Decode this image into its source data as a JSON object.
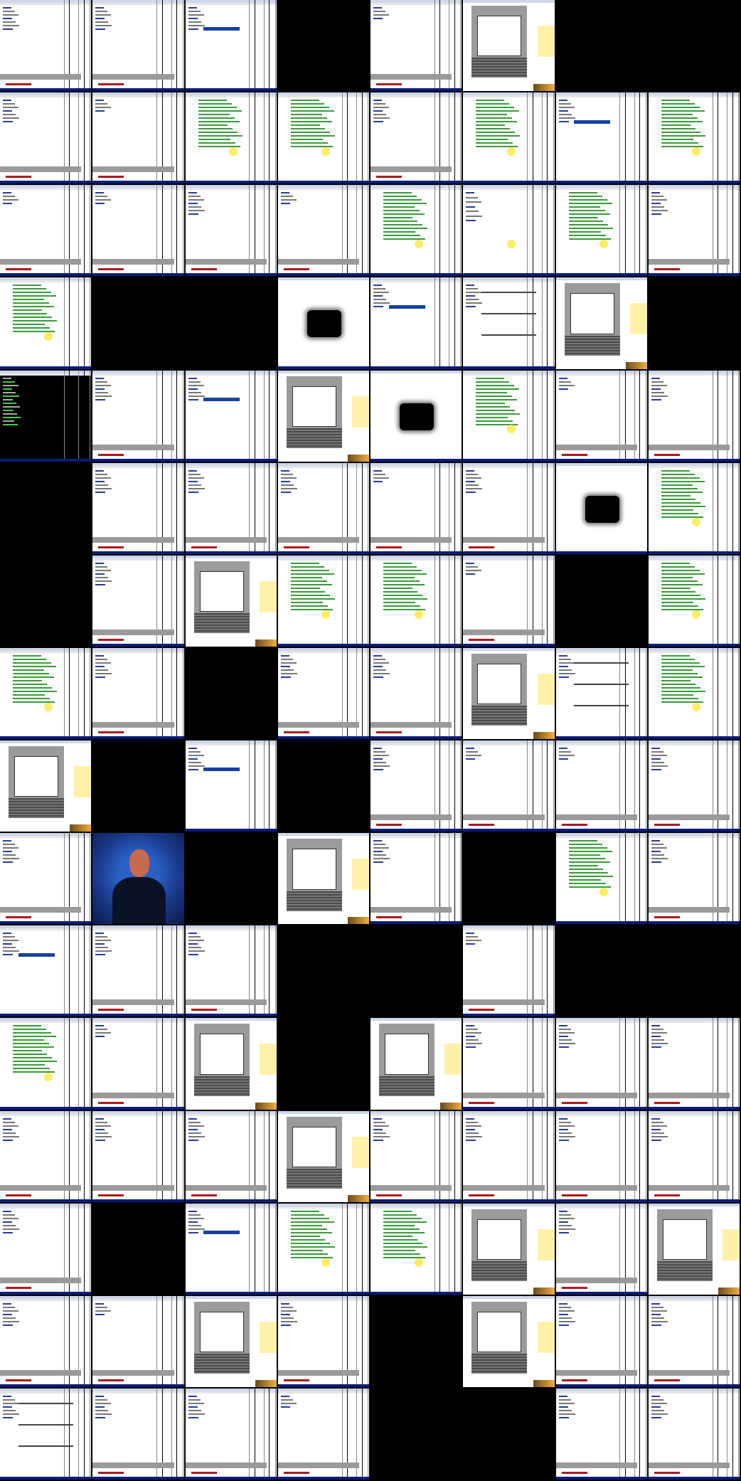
{
  "screen": {
    "description_free": true,
    "tiles": [
      {
        "k": "win",
        "v": 0
      },
      {
        "k": "win",
        "v": 0
      },
      {
        "k": "win",
        "v": 1
      },
      {
        "k": "blank"
      },
      {
        "k": "win",
        "v": 2
      },
      {
        "k": "dlg"
      },
      {
        "k": "blank"
      },
      {
        "k": "blank"
      },
      {
        "k": "win",
        "v": 0
      },
      {
        "k": "win",
        "v": 2
      },
      {
        "k": "win",
        "v": 3
      },
      {
        "k": "win",
        "v": 3
      },
      {
        "k": "win",
        "v": 0
      },
      {
        "k": "win",
        "v": 3
      },
      {
        "k": "win",
        "v": 1
      },
      {
        "k": "win",
        "v": 3
      },
      {
        "k": "win",
        "v": 2
      },
      {
        "k": "win",
        "v": 2
      },
      {
        "k": "win",
        "v": 0
      },
      {
        "k": "win",
        "v": 2
      },
      {
        "k": "win",
        "v": 3
      },
      {
        "k": "win",
        "v": 4
      },
      {
        "k": "win",
        "v": 3
      },
      {
        "k": "win",
        "v": 0
      },
      {
        "k": "win",
        "v": 3
      },
      {
        "k": "blank"
      },
      {
        "k": "blank"
      },
      {
        "k": "box"
      },
      {
        "k": "win",
        "v": 1
      },
      {
        "k": "win",
        "v": 5
      },
      {
        "k": "dlg"
      },
      {
        "k": "blank"
      },
      {
        "k": "win",
        "v": 6
      },
      {
        "k": "win",
        "v": 0
      },
      {
        "k": "win",
        "v": 1
      },
      {
        "k": "dlg"
      },
      {
        "k": "box"
      },
      {
        "k": "win",
        "v": 3
      },
      {
        "k": "win",
        "v": 2
      },
      {
        "k": "win",
        "v": 0
      },
      {
        "k": "blank"
      },
      {
        "k": "win",
        "v": 0
      },
      {
        "k": "win",
        "v": 0
      },
      {
        "k": "win",
        "v": 0
      },
      {
        "k": "win",
        "v": 2
      },
      {
        "k": "win",
        "v": 0
      },
      {
        "k": "box"
      },
      {
        "k": "win",
        "v": 3
      },
      {
        "k": "blank"
      },
      {
        "k": "win",
        "v": 0
      },
      {
        "k": "dlg"
      },
      {
        "k": "win",
        "v": 3
      },
      {
        "k": "win",
        "v": 3
      },
      {
        "k": "win",
        "v": 2
      },
      {
        "k": "blank"
      },
      {
        "k": "win",
        "v": 3
      },
      {
        "k": "win",
        "v": 3
      },
      {
        "k": "win",
        "v": 0
      },
      {
        "k": "blank"
      },
      {
        "k": "win",
        "v": 0
      },
      {
        "k": "win",
        "v": 0
      },
      {
        "k": "dlg"
      },
      {
        "k": "win",
        "v": 5
      },
      {
        "k": "win",
        "v": 3
      },
      {
        "k": "dlg"
      },
      {
        "k": "blank"
      },
      {
        "k": "win",
        "v": 1
      },
      {
        "k": "blank"
      },
      {
        "k": "win",
        "v": 0
      },
      {
        "k": "win",
        "v": 2
      },
      {
        "k": "win",
        "v": 2
      },
      {
        "k": "win",
        "v": 0
      },
      {
        "k": "win",
        "v": 0
      },
      {
        "k": "photo"
      },
      {
        "k": "blank"
      },
      {
        "k": "dlg"
      },
      {
        "k": "win",
        "v": 0
      },
      {
        "k": "blank"
      },
      {
        "k": "win",
        "v": 3
      },
      {
        "k": "win",
        "v": 0
      },
      {
        "k": "win",
        "v": 1
      },
      {
        "k": "win",
        "v": 0
      },
      {
        "k": "win",
        "v": 0
      },
      {
        "k": "blank"
      },
      {
        "k": "blank"
      },
      {
        "k": "win",
        "v": 2
      },
      {
        "k": "blank"
      },
      {
        "k": "blank"
      },
      {
        "k": "win",
        "v": 3
      },
      {
        "k": "win",
        "v": 2
      },
      {
        "k": "dlg"
      },
      {
        "k": "blank"
      },
      {
        "k": "dlg"
      },
      {
        "k": "win",
        "v": 0
      },
      {
        "k": "win",
        "v": 0
      },
      {
        "k": "win",
        "v": 0
      },
      {
        "k": "win",
        "v": 0
      },
      {
        "k": "win",
        "v": 0
      },
      {
        "k": "win",
        "v": 0
      },
      {
        "k": "dlg"
      },
      {
        "k": "win",
        "v": 0
      },
      {
        "k": "win",
        "v": 0
      },
      {
        "k": "win",
        "v": 0
      },
      {
        "k": "win",
        "v": 0
      },
      {
        "k": "win",
        "v": 0
      },
      {
        "k": "blank"
      },
      {
        "k": "win",
        "v": 1
      },
      {
        "k": "win",
        "v": 3
      },
      {
        "k": "win",
        "v": 3
      },
      {
        "k": "dlg"
      },
      {
        "k": "win",
        "v": 0
      },
      {
        "k": "dlg"
      },
      {
        "k": "win",
        "v": 0
      },
      {
        "k": "win",
        "v": 2
      },
      {
        "k": "dlg"
      },
      {
        "k": "win",
        "v": 0
      },
      {
        "k": "blank"
      },
      {
        "k": "dlg"
      },
      {
        "k": "win",
        "v": 0
      },
      {
        "k": "win",
        "v": 0
      },
      {
        "k": "win",
        "v": 5
      },
      {
        "k": "win",
        "v": 0
      },
      {
        "k": "win",
        "v": 0
      },
      {
        "k": "win",
        "v": 2
      },
      {
        "k": "blank"
      },
      {
        "k": "blank"
      },
      {
        "k": "win",
        "v": 0
      },
      {
        "k": "win",
        "v": 0
      }
    ]
  },
  "colors": {
    "statusbar": "#0a1c7a",
    "highlight": "#ffe94a",
    "green_text": "#3a9a3a",
    "blue_text": "#2a3a9a",
    "red_accent": "#b01818"
  }
}
